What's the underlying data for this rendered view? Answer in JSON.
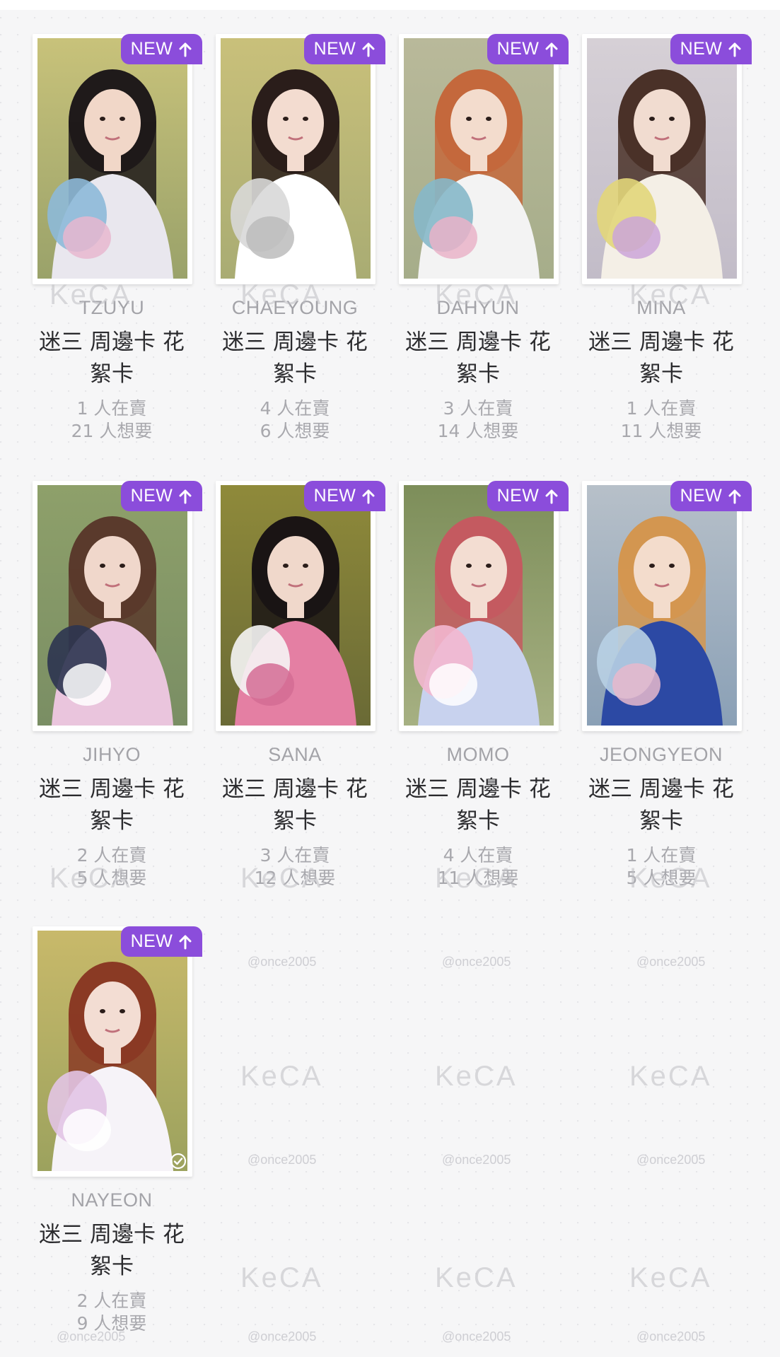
{
  "badge": {
    "label": "NEW"
  },
  "cards": [
    {
      "member": "TZUYU",
      "title": "迷三 周邊卡 花絮卡",
      "sellers": "1 人在賣",
      "wanters": "21 人想要"
    },
    {
      "member": "CHAEYOUNG",
      "title": "迷三 周邊卡 花絮卡",
      "sellers": "4 人在賣",
      "wanters": "6 人想要"
    },
    {
      "member": "DAHYUN",
      "title": "迷三 周邊卡 花絮卡",
      "sellers": "3 人在賣",
      "wanters": "14 人想要"
    },
    {
      "member": "MINA",
      "title": "迷三 周邊卡 花絮卡",
      "sellers": "1 人在賣",
      "wanters": "11 人想要"
    },
    {
      "member": "JIHYO",
      "title": "迷三 周邊卡 花絮卡",
      "sellers": "2 人在賣",
      "wanters": "5 人想要"
    },
    {
      "member": "SANA",
      "title": "迷三 周邊卡 花絮卡",
      "sellers": "3 人在賣",
      "wanters": "12 人想要"
    },
    {
      "member": "MOMO",
      "title": "迷三 周邊卡 花絮卡",
      "sellers": "4 人在賣",
      "wanters": "11 人想要"
    },
    {
      "member": "JEONGYEON",
      "title": "迷三 周邊卡 花絮卡",
      "sellers": "1 人在賣",
      "wanters": "5 人想要"
    },
    {
      "member": "NAYEON",
      "title": "迷三 周邊卡 花絮卡",
      "sellers": "2 人在賣",
      "wanters": "9 人想要",
      "owned": true
    }
  ],
  "watermark": {
    "logo": "KeCA",
    "handle": "@once2005"
  },
  "colors": {
    "badge": "#8b4ddb",
    "background": "#f6f6f7",
    "title_text": "#2b2b2e",
    "muted_text": "#a3a3a8"
  },
  "icons": {
    "badge_arrow": "arrow-up-icon",
    "owned": "check-circle-icon"
  }
}
